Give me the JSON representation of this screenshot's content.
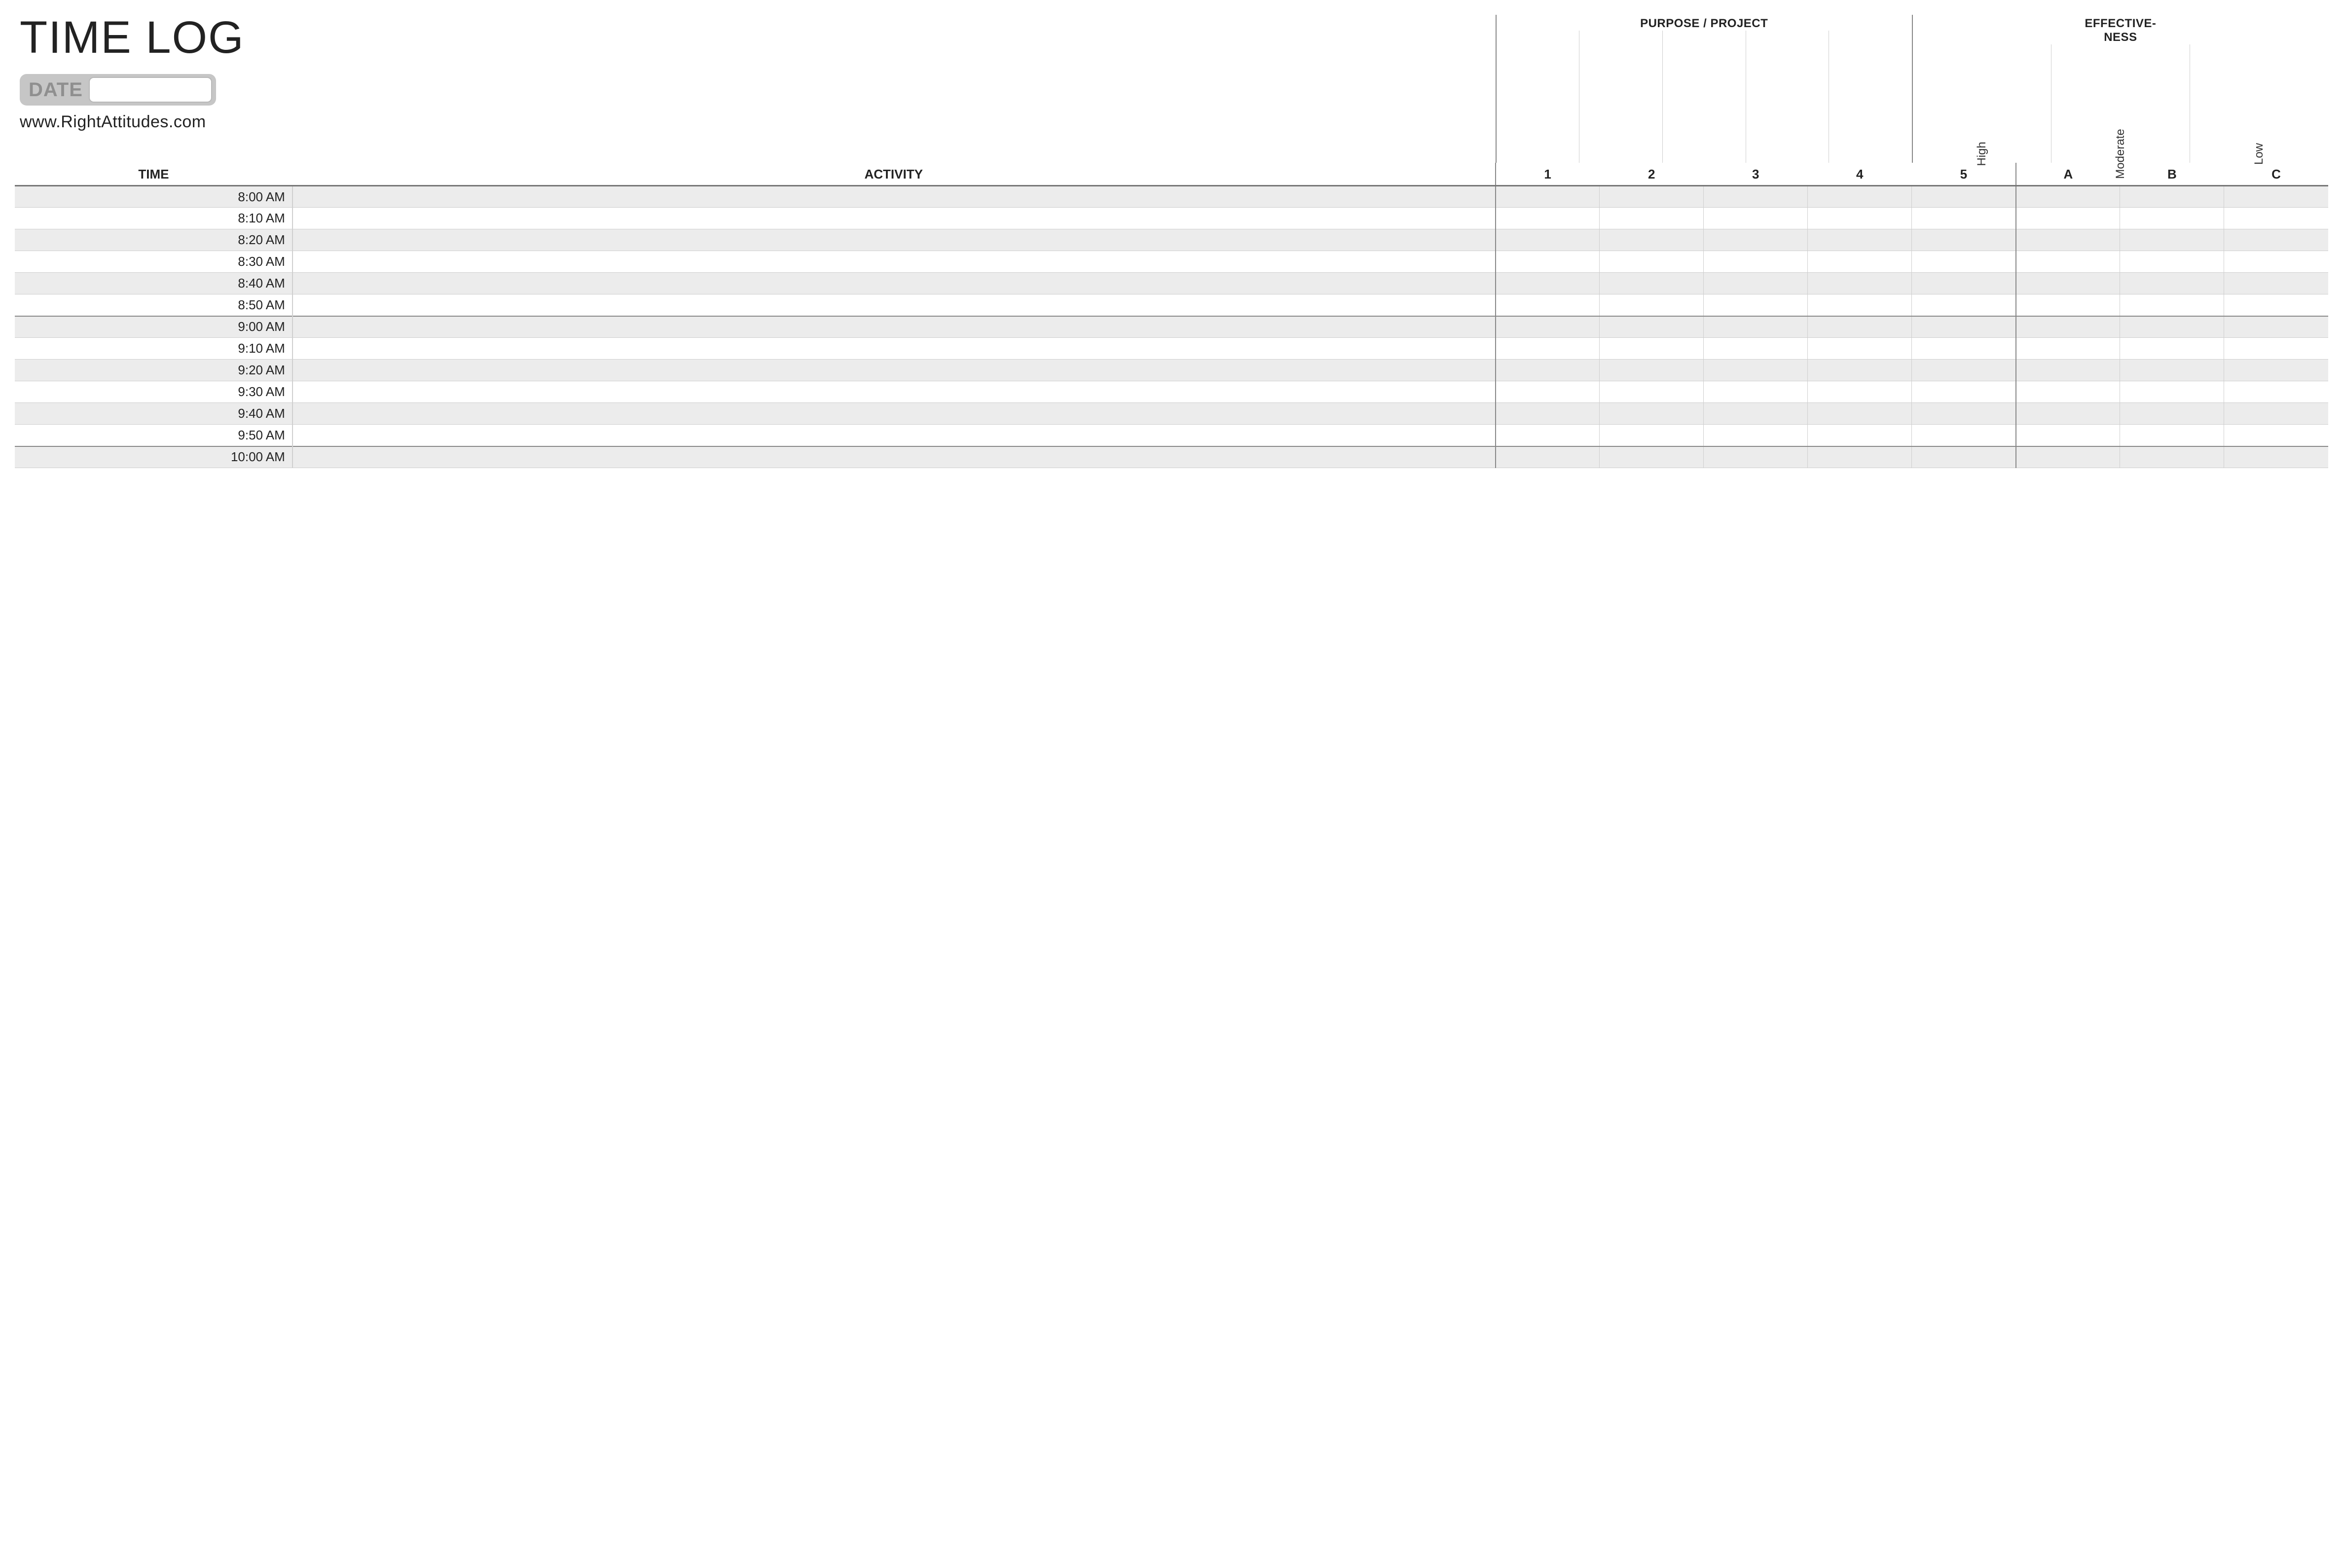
{
  "title": "TIME LOG",
  "date_label": "DATE",
  "date_value": "",
  "website": "www.RightAttitudes.com",
  "headers": {
    "time": "TIME",
    "activity": "ACTIVITY",
    "purpose_group": "PURPOSE / PROJECT",
    "effectiveness_group": "EFFECTIVE-\nNESS",
    "purpose_cols": [
      "1",
      "2",
      "3",
      "4",
      "5"
    ],
    "effectiveness_cols": [
      "A",
      "B",
      "C"
    ],
    "effectiveness_labels": [
      "High",
      "Moderate",
      "Low"
    ]
  },
  "rows": [
    {
      "time": "8:00 AM",
      "shaded": true,
      "hour_start": true
    },
    {
      "time": "8:10 AM",
      "shaded": false,
      "hour_start": false
    },
    {
      "time": "8:20 AM",
      "shaded": true,
      "hour_start": false
    },
    {
      "time": "8:30 AM",
      "shaded": false,
      "hour_start": false
    },
    {
      "time": "8:40 AM",
      "shaded": true,
      "hour_start": false
    },
    {
      "time": "8:50 AM",
      "shaded": false,
      "hour_start": false
    },
    {
      "time": "9:00 AM",
      "shaded": true,
      "hour_start": true
    },
    {
      "time": "9:10 AM",
      "shaded": false,
      "hour_start": false
    },
    {
      "time": "9:20 AM",
      "shaded": true,
      "hour_start": false
    },
    {
      "time": "9:30 AM",
      "shaded": false,
      "hour_start": false
    },
    {
      "time": "9:40 AM",
      "shaded": true,
      "hour_start": false
    },
    {
      "time": "9:50 AM",
      "shaded": false,
      "hour_start": false
    },
    {
      "time": "10:00 AM",
      "shaded": true,
      "hour_start": true
    }
  ]
}
